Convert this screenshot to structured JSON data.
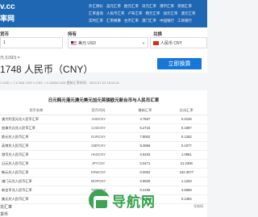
{
  "header": {
    "logo_line1": "v.cc",
    "logo_line2": "率网",
    "nav_rows": [
      [
        "外汇牌价",
        "美元汇率",
        "欧元汇率",
        "日元汇率",
        "港币汇率",
        "英镑汇率"
      ],
      [
        "汇率查询",
        "人民币汇率",
        "卢布汇率",
        "韩元汇率",
        "加元汇率",
        "澳元汇率"
      ],
      [
        "实时汇率",
        "汇率换算",
        "台币汇率",
        "澳门汇率",
        "中国银行",
        "工商银行"
      ]
    ]
  },
  "converter": {
    "from_label": "货币",
    "from_value": "1",
    "to_label": "兑换",
    "currency_from_label": "持有",
    "currency_from": "美元 USD",
    "currency_to": "人民币 CNY",
    "convert_button": "立即换算"
  },
  "result": {
    "unit_line": "元 (USD) =",
    "amount": "1748 人民币（CNY）",
    "rate_line": "1 USD = 7.17481 CNY  1 CNY = 0.13994 USD   更新汇率时间：2024-07-22 18:14:41"
  },
  "table": {
    "title": "日元韩元港元澳元美元加元英镑欧元新台币与人民币汇率",
    "headers": [
      "货币名称",
      "货币代码",
      "最新汇率",
      "反向汇率"
    ],
    "rows": [
      [
        "澳大利亚元兑人民币汇率",
        "AUDCNY",
        "4.7937",
        "0.2126"
      ],
      [
        "加拿大元兑人民币汇率",
        "CADCNY",
        "5.2715",
        "0.1897"
      ],
      [
        "欧元兑人民币汇率",
        "EURCNY",
        "7.8002",
        "0.1282"
      ],
      [
        "英镑兑人民币汇率",
        "GBPCNY",
        "9.2866",
        "0.1077"
      ],
      [
        "港币兑人民币汇率",
        "HKDCNY",
        "0.9193",
        "1.0881"
      ],
      [
        "日元兑人民币汇率",
        "JPYCNY",
        "0.0471",
        "21.2300"
      ],
      [
        "韩元兑人民币汇率",
        "KRWCNY",
        "0.0052",
        "192.3077"
      ],
      [
        "澳门元兑人民币汇率",
        "MOPCNY",
        "0.8926",
        "1.1203"
      ],
      [
        "新台币兑人民币汇率",
        "TWDCNY",
        "0.2195",
        "4.5558"
      ],
      [
        "美元兑人民币汇率",
        "USDCNY",
        "7.1748",
        "0.1394"
      ]
    ]
  },
  "footer": {
    "label_a": "兑汇率",
    "label_b": "货币"
  },
  "watermark": {
    "text": "导航网",
    "side_text": "导航网"
  },
  "colors": {
    "brand_blue": "#1f66b3",
    "button_blue": "#1677d9",
    "watermark_green": "#1e9a3a"
  }
}
